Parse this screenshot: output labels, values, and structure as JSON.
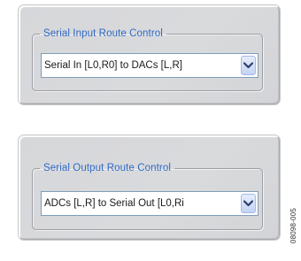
{
  "panels": [
    {
      "legend": "Serial Input Route Control",
      "select_value": "Serial In [L0,R0] to DACs [L,R]",
      "arrow_icon": "chevron-down-icon"
    },
    {
      "legend": "Serial Output Route Control",
      "select_value": "ADCs [L,R] to Serial Out [L0,Ri",
      "arrow_icon": "chevron-down-icon"
    }
  ],
  "figure_code": "08098-005",
  "colors": {
    "legend_text": "#2f68c4",
    "panel_bg": "#d9dadc",
    "select_border": "#7f9db9"
  }
}
